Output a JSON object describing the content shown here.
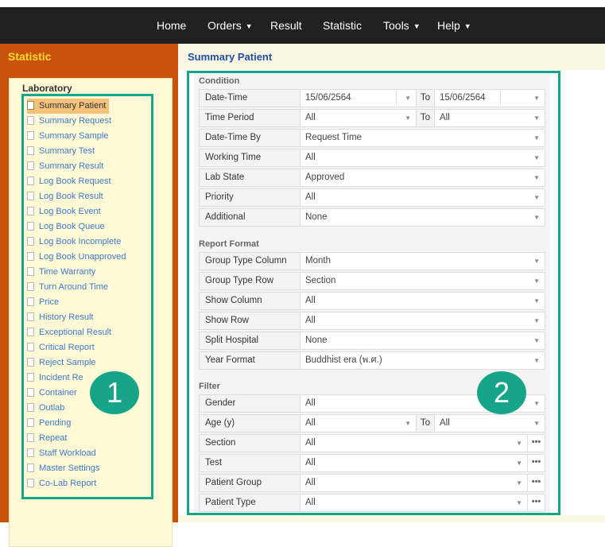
{
  "nav": {
    "items": [
      {
        "label": "Home",
        "has_dropdown": false
      },
      {
        "label": "Orders",
        "has_dropdown": true
      },
      {
        "label": "Result",
        "has_dropdown": false
      },
      {
        "label": "Statistic",
        "has_dropdown": false
      },
      {
        "label": "Tools",
        "has_dropdown": true
      },
      {
        "label": "Help",
        "has_dropdown": true
      }
    ]
  },
  "sidebar": {
    "title": "Statistic",
    "heading": "Laboratory",
    "items": [
      {
        "label": "Summary Patient",
        "active": true
      },
      {
        "label": "Summary Request"
      },
      {
        "label": "Summary Sample"
      },
      {
        "label": "Summary Test"
      },
      {
        "label": "Summary Result"
      },
      {
        "label": "Log Book Request"
      },
      {
        "label": "Log Book Result"
      },
      {
        "label": "Log Book Event"
      },
      {
        "label": "Log Book Queue"
      },
      {
        "label": "Log Book Incomplete"
      },
      {
        "label": "Log Book Unapproved"
      },
      {
        "label": "Time Warranty"
      },
      {
        "label": "Turn Around Time"
      },
      {
        "label": "Price"
      },
      {
        "label": "History Result"
      },
      {
        "label": "Exceptional Result"
      },
      {
        "label": "Critical Report"
      },
      {
        "label": "Reject Sample"
      },
      {
        "label": "Incident Re"
      },
      {
        "label": "Container"
      },
      {
        "label": "Outlab"
      },
      {
        "label": "Pending"
      },
      {
        "label": "Repeat"
      },
      {
        "label": "Staff Workload"
      },
      {
        "label": "Master Settings"
      },
      {
        "label": "Co-Lab Report"
      }
    ]
  },
  "page": {
    "title": "Summary Patient"
  },
  "condition": {
    "title": "Condition",
    "datetime": {
      "label": "Date-Time",
      "from": "15/06/2564",
      "to_label": "To",
      "to": "15/06/2564"
    },
    "time_period": {
      "label": "Time Period",
      "from": "All",
      "to_label": "To",
      "to": "All"
    },
    "datetime_by": {
      "label": "Date-Time By",
      "value": "Request Time"
    },
    "working_time": {
      "label": "Working Time",
      "value": "All"
    },
    "lab_state": {
      "label": "Lab State",
      "value": "Approved"
    },
    "priority": {
      "label": "Priority",
      "value": "All"
    },
    "additional": {
      "label": "Additional",
      "value": "None"
    }
  },
  "report_format": {
    "title": "Report Format",
    "group_type_column": {
      "label": "Group Type Column",
      "value": "Month"
    },
    "group_type_row": {
      "label": "Group Type Row",
      "value": "Section"
    },
    "show_column": {
      "label": "Show Column",
      "value": "All"
    },
    "show_row": {
      "label": "Show Row",
      "value": "All"
    },
    "split_hospital": {
      "label": "Split Hospital",
      "value": "None"
    },
    "year_format": {
      "label": "Year Format",
      "value": "Buddhist era (พ.ศ.)"
    }
  },
  "filter": {
    "title": "Filter",
    "gender": {
      "label": "Gender",
      "value": "All"
    },
    "age": {
      "label": "Age (y)",
      "from": "All",
      "to_label": "To",
      "to": "All"
    },
    "section": {
      "label": "Section",
      "value": "All"
    },
    "test": {
      "label": "Test",
      "value": "All"
    },
    "patient_group": {
      "label": "Patient Group",
      "value": "All"
    },
    "patient_type": {
      "label": "Patient Type",
      "value": "All"
    }
  },
  "icons": {
    "dropdown": "chevron-down-icon",
    "more": "ellipsis-icon",
    "document": "document-icon"
  },
  "annotations": {
    "badge1": "1",
    "badge2": "2"
  },
  "colors": {
    "accent_frame": "#17a589",
    "sidebar_bg": "#c9530a",
    "sidebar_title": "#ffdc29",
    "link": "#3d7bc9",
    "navbar": "#212121"
  }
}
